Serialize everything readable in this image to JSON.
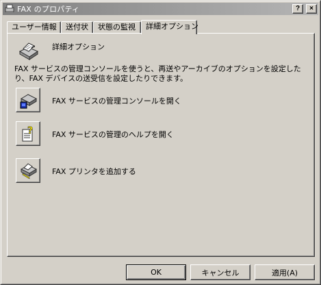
{
  "window": {
    "title": "FAX のプロパティ",
    "help_button": "?",
    "close_button": "×"
  },
  "tabs": [
    {
      "label": "ユーザー情報"
    },
    {
      "label": "送付状"
    },
    {
      "label": "状態の監視"
    },
    {
      "label": "詳細オプション"
    }
  ],
  "panel": {
    "title": "詳細オプション",
    "description": "FAX サービスの管理コンソールを使うと、再送やアーカイブのオプションを設定したり、FAX デバイスの送受信を設定したりできます。",
    "actions": [
      {
        "label": "FAX サービスの管理コンソールを開く",
        "icon": "fax-console-icon"
      },
      {
        "label": "FAX サービスの管理のヘルプを開く",
        "icon": "help-document-icon"
      },
      {
        "label": "FAX プリンタを追加する",
        "icon": "add-fax-printer-icon"
      }
    ]
  },
  "buttons": {
    "ok": "OK",
    "cancel": "キャンセル",
    "apply": "適用(A)"
  }
}
